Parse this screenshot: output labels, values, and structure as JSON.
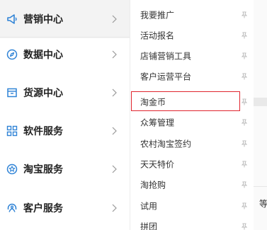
{
  "left_nav": {
    "items": [
      {
        "label": "营销中心",
        "icon": "megaphone-icon",
        "active": true
      },
      {
        "label": "数据中心",
        "icon": "compass-icon",
        "active": false
      },
      {
        "label": "货源中心",
        "icon": "box-icon",
        "active": false
      },
      {
        "label": "软件服务",
        "icon": "grid-icon",
        "active": false
      },
      {
        "label": "淘宝服务",
        "icon": "star-badge-icon",
        "active": false
      },
      {
        "label": "客户服务",
        "icon": "headset-icon",
        "active": false
      }
    ]
  },
  "submenu": {
    "items": [
      {
        "label": "我要推广"
      },
      {
        "label": "活动报名"
      },
      {
        "label": "店铺营销工具"
      },
      {
        "label": "客户运营平台"
      },
      {
        "label": "淘金币",
        "highlighted": true
      },
      {
        "label": "众筹管理"
      },
      {
        "label": "农村淘宝签约"
      },
      {
        "label": "天天特价"
      },
      {
        "label": "淘抢购"
      },
      {
        "label": "试用"
      },
      {
        "label": "拼团"
      }
    ]
  },
  "right_partial": {
    "text": "等"
  },
  "colors": {
    "accent": "#e0252e",
    "icon": "#2f83d6",
    "text": "#222222"
  }
}
